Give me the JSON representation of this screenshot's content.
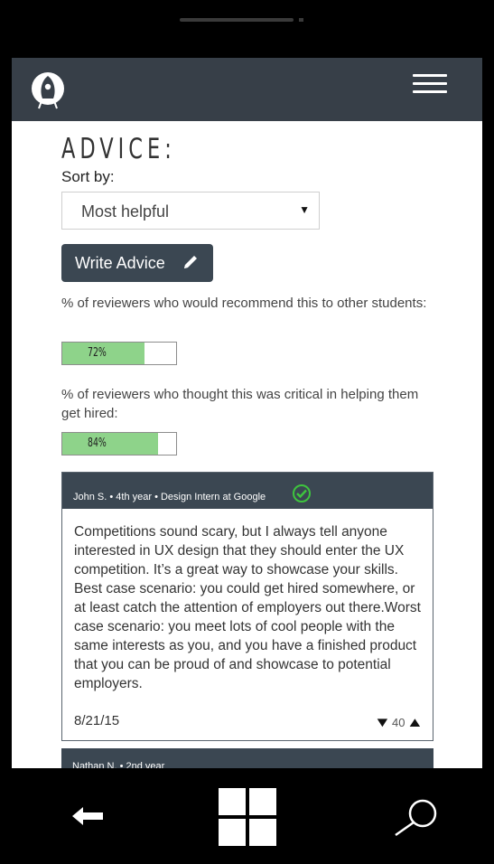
{
  "app": {
    "logo_icon": "rocket-logo-icon",
    "menu_icon": "hamburger-menu-icon"
  },
  "section": {
    "title": "ADVICE:"
  },
  "sort": {
    "label": "Sort by:",
    "selected": "Most helpful"
  },
  "write_button": {
    "label": "Write Advice",
    "icon": "pencil-icon"
  },
  "stats": [
    {
      "text": "% of reviewers who would recommend this to other students:",
      "percent": 72,
      "label": "72%"
    },
    {
      "text": "% of reviewers who thought this was critical in helping them get hired:",
      "percent": 84,
      "label": "84%"
    }
  ],
  "reviews": [
    {
      "author": "John S. • 4th year • Design Intern at Google",
      "verified_icon": "verified-check-icon",
      "body": "Competitions sound scary, but I always tell anyone interested in UX design that they should enter the UX competition. It’s a great way to showcase your skills. Best case scenario: you could get hired somewhere, or at least catch the attention of employers out there.Worst case scenario: you meet lots of cool people with the same interests as you, and you have a finished product that you can be proud of and showcase to potential employers.",
      "date": "8/21/15",
      "votes": "40"
    },
    {
      "author": "Nathan N. • 2nd year"
    }
  ],
  "colors": {
    "header": "#373f48",
    "accent": "#3b4752",
    "bar_fill": "#8ed38a",
    "verified": "#3ec43e"
  }
}
